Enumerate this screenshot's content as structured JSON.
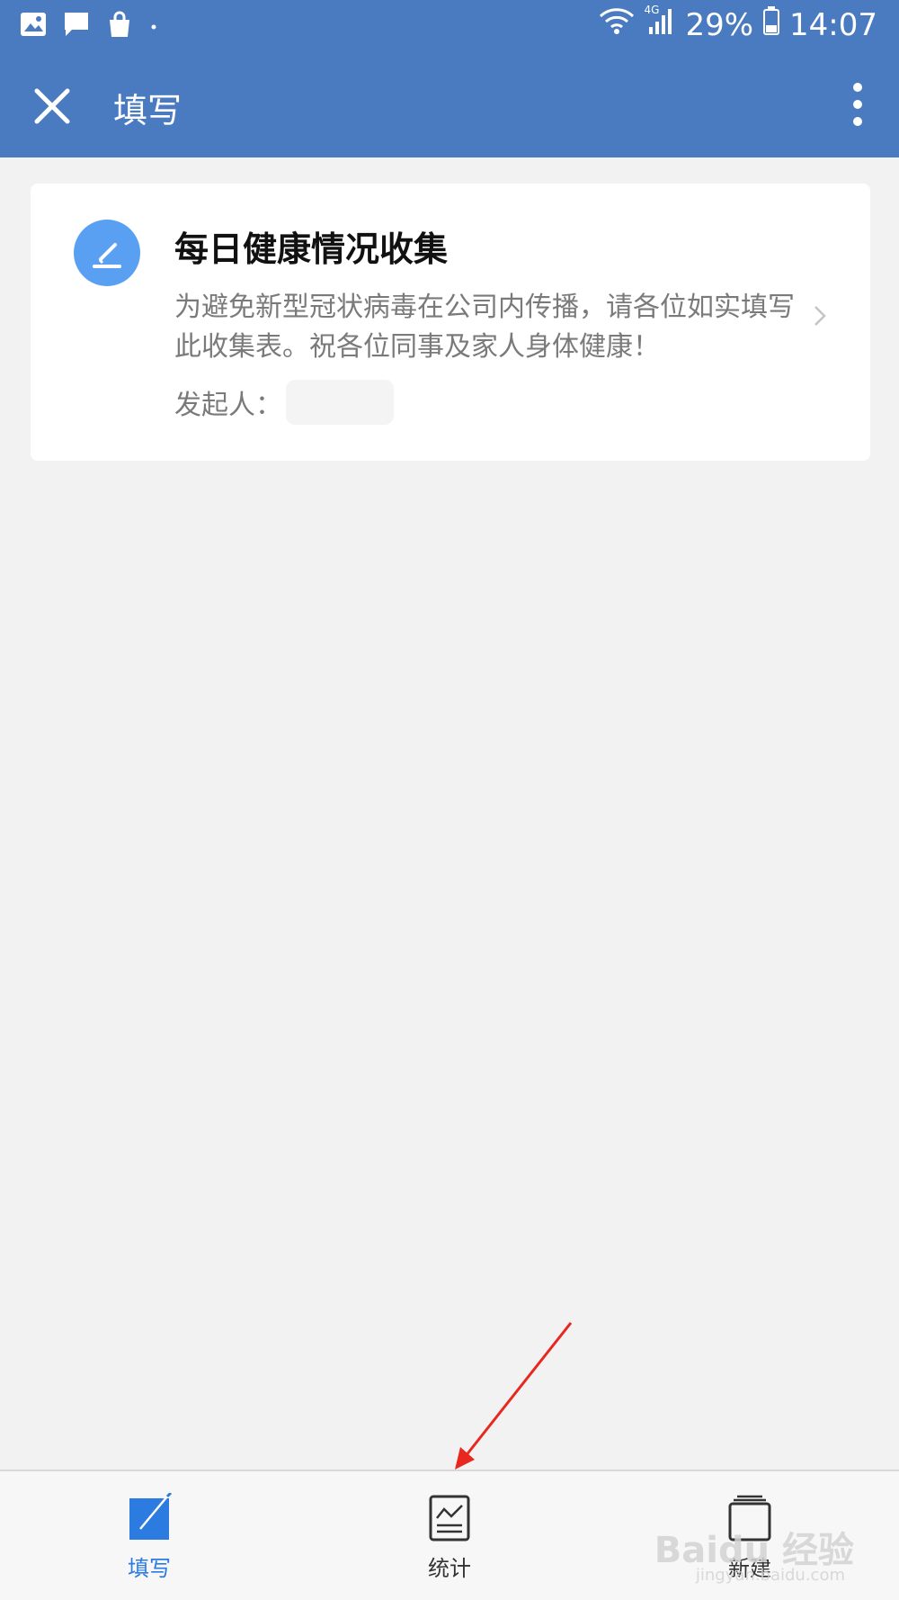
{
  "status_bar": {
    "battery_percent": "29%",
    "time": "14:07",
    "network": "4G",
    "icons": [
      "image-icon",
      "message-icon",
      "shopping-bag-icon",
      "dot-icon",
      "wifi-icon",
      "signal-icon",
      "battery-icon"
    ]
  },
  "app_bar": {
    "title": "填写",
    "close_icon": "close-icon",
    "more_icon": "more-vertical-icon"
  },
  "card": {
    "title": "每日健康情况收集",
    "description": "为避免新型冠状病毒在公司内传播，请各位如实填写此收集表。祝各位同事及家人身体健康！",
    "initiator_label": "发起人：",
    "icon": "edit-icon"
  },
  "tabs": [
    {
      "label": "填写",
      "icon": "edit-square-icon",
      "active": true
    },
    {
      "label": "统计",
      "icon": "stats-document-icon",
      "active": false
    },
    {
      "label": "新建",
      "icon": "new-form-icon",
      "active": false
    }
  ],
  "watermark": {
    "text": "Baidu 经验",
    "sub": "jingyan.baidu.com"
  },
  "colors": {
    "primary": "#4a7bc1",
    "accent": "#2b7be0",
    "annotation": "#e8281e"
  }
}
